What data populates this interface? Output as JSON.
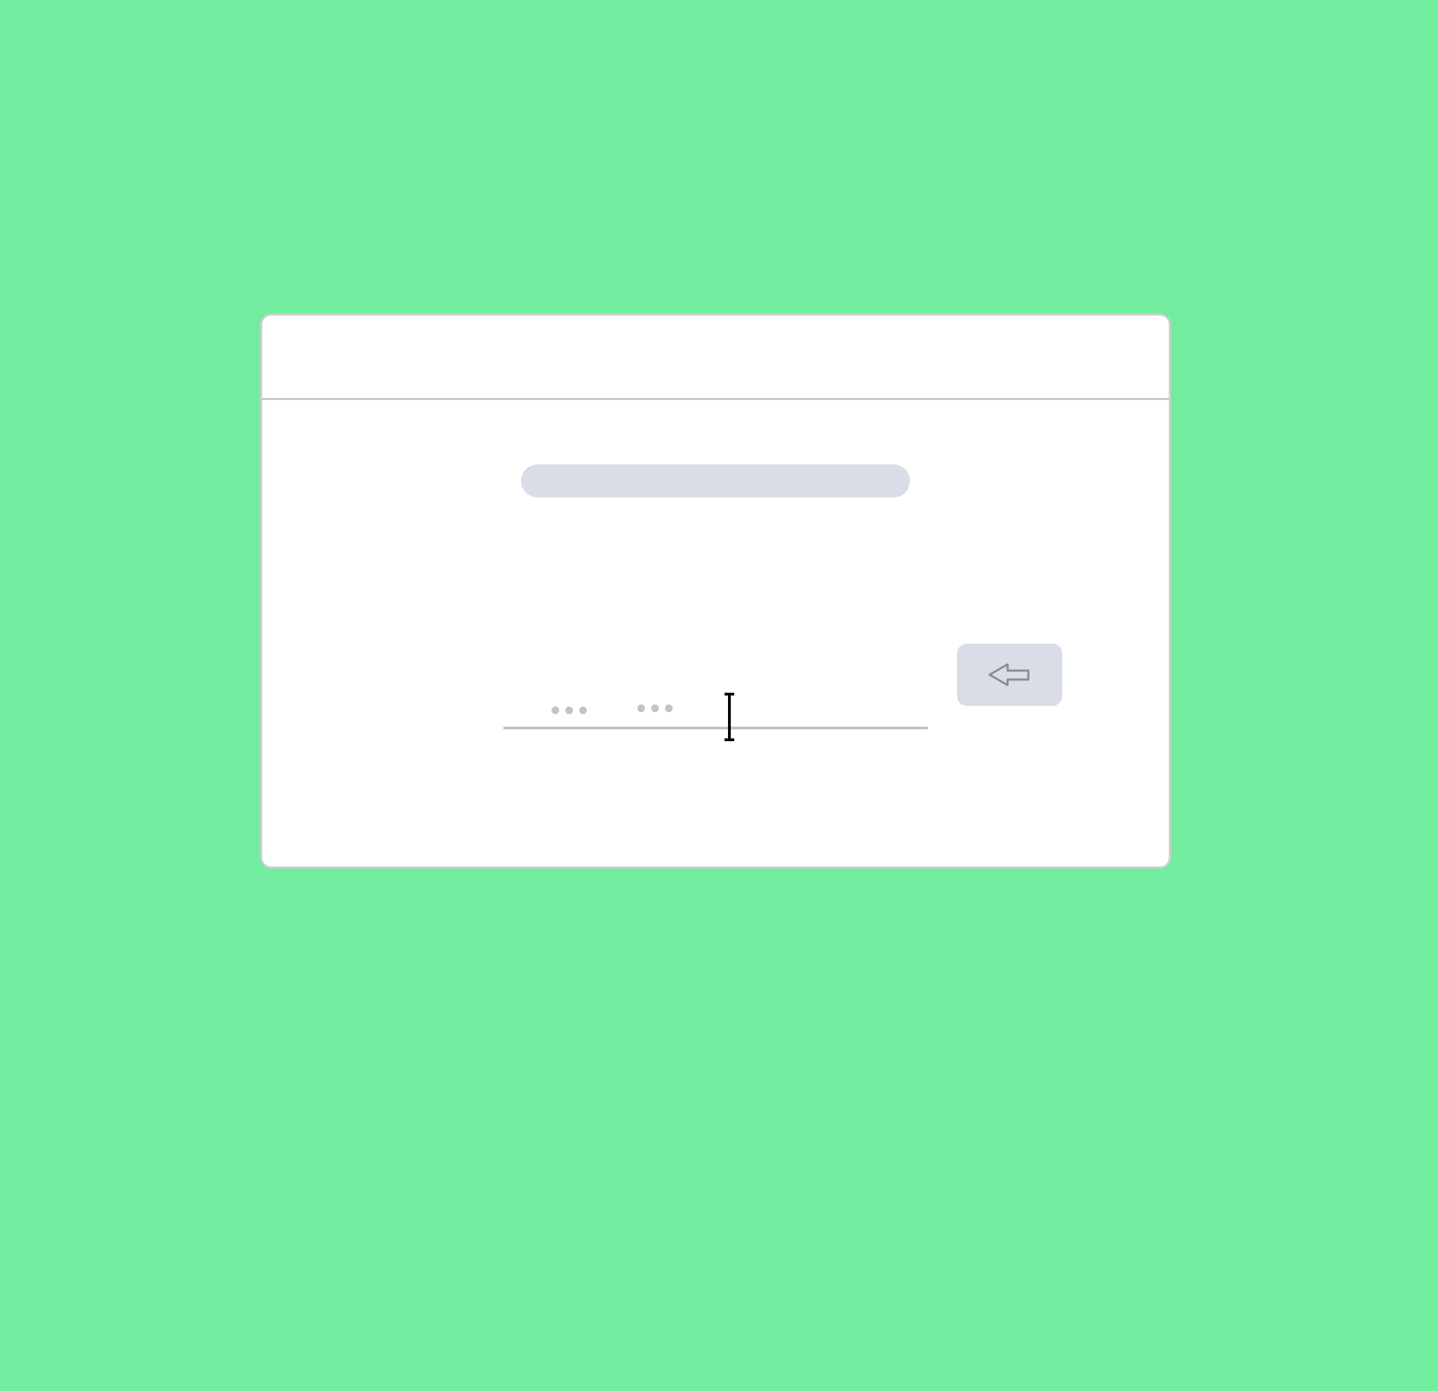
{
  "screen": {
    "background_color": "#72ed9f"
  },
  "dialog": {
    "background_color": "#ffffff",
    "border_color": "#cfcfcf",
    "header": {
      "title": ""
    },
    "title_placeholder": {
      "color": "#d9dde7"
    },
    "password_field": {
      "value_masked_groups": 2,
      "dots_per_group": 3,
      "underline_color": "#c3c3c3"
    },
    "submit_button": {
      "icon": "arrow-left-icon",
      "background_color": "#d9dde7"
    },
    "cursor": {
      "icon": "text-cursor-icon"
    }
  }
}
